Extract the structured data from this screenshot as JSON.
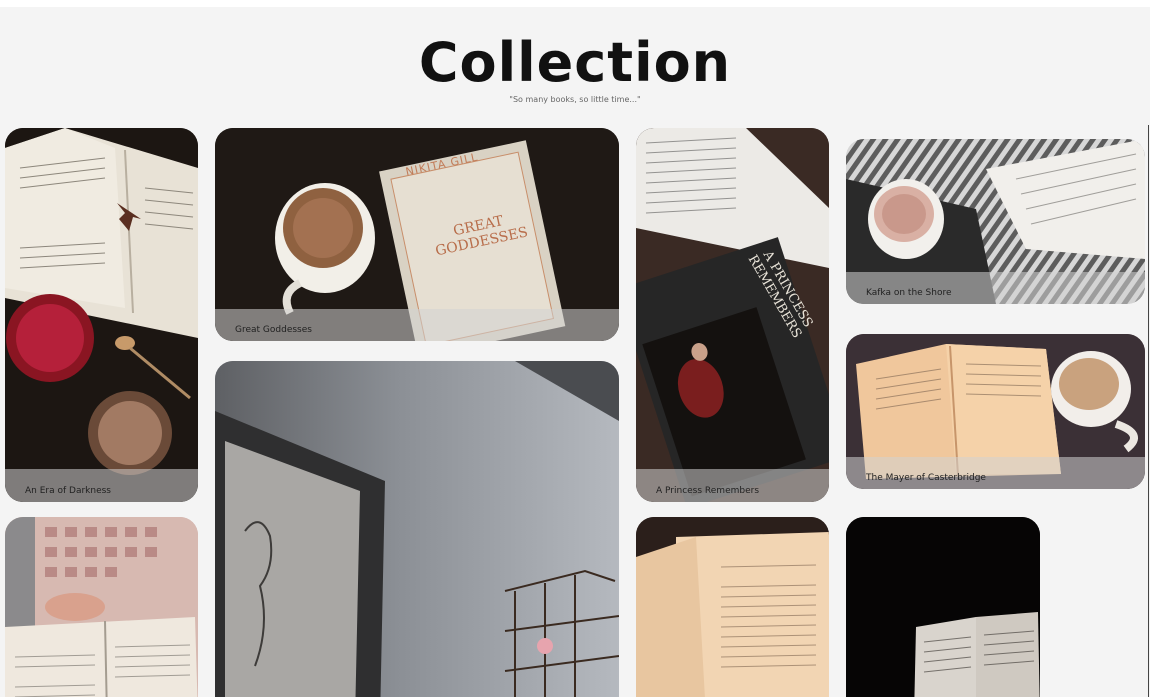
{
  "header": {
    "title": "Collection",
    "subtitle": "\"So many books, so little time...\""
  },
  "cards": [
    {
      "caption": "An Era of Darkness"
    },
    {
      "caption": "Great Goddesses"
    },
    {
      "caption": "A Princess Remembers"
    },
    {
      "caption": "Kafka on the Shore"
    },
    {
      "caption": "The Mayer of Casterbridge"
    },
    {
      "caption": ""
    },
    {
      "caption": ""
    },
    {
      "caption": ""
    },
    {
      "caption": ""
    }
  ],
  "book_covers": {
    "great_goddesses_author": "NIKITA GILL",
    "great_goddesses_title": "GREAT GODDESSES",
    "princess_title": "A PRINCESS REMEMBERS"
  }
}
